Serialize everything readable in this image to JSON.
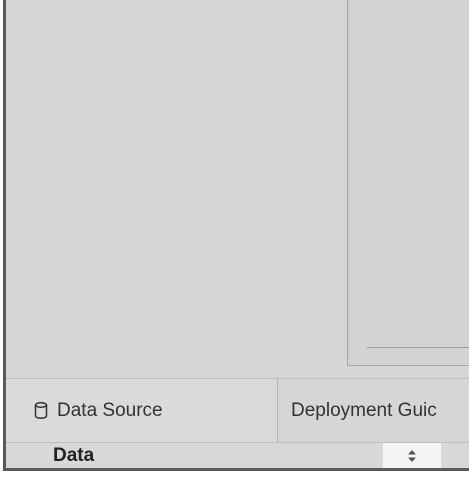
{
  "tabs": [
    {
      "label": "Data Source",
      "icon": "database-icon"
    },
    {
      "label": "Deployment Guic"
    }
  ],
  "data_pane": {
    "title": "Data",
    "sort_icon": "sort-updown-icon"
  },
  "colors": {
    "workspace_bg": "#d6d6d6",
    "border_dark": "#5a5a5a",
    "sort_box_bg": "#f4f4f4"
  }
}
